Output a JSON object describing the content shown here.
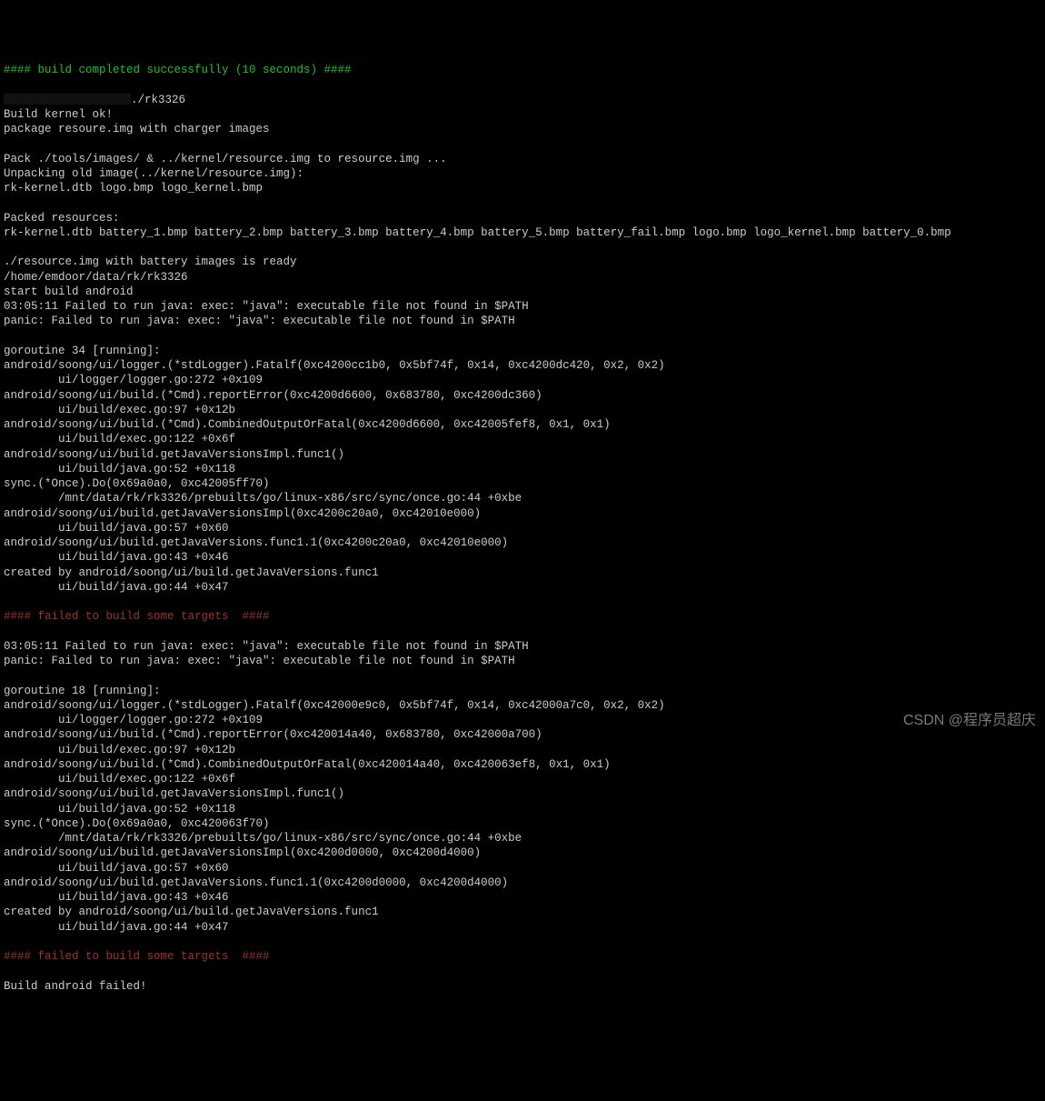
{
  "success_line": "#### build completed successfully (10 seconds) ####",
  "after_redacted": "./rk3326",
  "block1": "Build kernel ok!\npackage resoure.img with charger images\n\nPack ./tools/images/ & ../kernel/resource.img to resource.img ...\nUnpacking old image(../kernel/resource.img):\nrk-kernel.dtb logo.bmp logo_kernel.bmp\n\nPacked resources:\nrk-kernel.dtb battery_1.bmp battery_2.bmp battery_3.bmp battery_4.bmp battery_5.bmp battery_fail.bmp logo.bmp logo_kernel.bmp battery_0.bmp\n\n./resource.img with battery images is ready\n/home/emdoor/data/rk/rk3326\nstart build android\n03:05:11 Failed to run java: exec: \"java\": executable file not found in $PATH\npanic: Failed to run java: exec: \"java\": executable file not found in $PATH\n\ngoroutine 34 [running]:\nandroid/soong/ui/logger.(*stdLogger).Fatalf(0xc4200cc1b0, 0x5bf74f, 0x14, 0xc4200dc420, 0x2, 0x2)\n        ui/logger/logger.go:272 +0x109\nandroid/soong/ui/build.(*Cmd).reportError(0xc4200d6600, 0x683780, 0xc4200dc360)\n        ui/build/exec.go:97 +0x12b\nandroid/soong/ui/build.(*Cmd).CombinedOutputOrFatal(0xc4200d6600, 0xc42005fef8, 0x1, 0x1)\n        ui/build/exec.go:122 +0x6f\nandroid/soong/ui/build.getJavaVersionsImpl.func1()\n        ui/build/java.go:52 +0x118\nsync.(*Once).Do(0x69a0a0, 0xc42005ff70)\n        /mnt/data/rk/rk3326/prebuilts/go/linux-x86/src/sync/once.go:44 +0xbe\nandroid/soong/ui/build.getJavaVersionsImpl(0xc4200c20a0, 0xc42010e000)\n        ui/build/java.go:57 +0x60\nandroid/soong/ui/build.getJavaVersions.func1.1(0xc4200c20a0, 0xc42010e000)\n        ui/build/java.go:43 +0x46\ncreated by android/soong/ui/build.getJavaVersions.func1\n        ui/build/java.go:44 +0x47",
  "fail_line": "#### failed to build some targets  ####",
  "block2": "03:05:11 Failed to run java: exec: \"java\": executable file not found in $PATH\npanic: Failed to run java: exec: \"java\": executable file not found in $PATH\n\ngoroutine 18 [running]:\nandroid/soong/ui/logger.(*stdLogger).Fatalf(0xc42000e9c0, 0x5bf74f, 0x14, 0xc42000a7c0, 0x2, 0x2)\n        ui/logger/logger.go:272 +0x109\nandroid/soong/ui/build.(*Cmd).reportError(0xc420014a40, 0x683780, 0xc42000a700)\n        ui/build/exec.go:97 +0x12b\nandroid/soong/ui/build.(*Cmd).CombinedOutputOrFatal(0xc420014a40, 0xc420063ef8, 0x1, 0x1)\n        ui/build/exec.go:122 +0x6f\nandroid/soong/ui/build.getJavaVersionsImpl.func1()\n        ui/build/java.go:52 +0x118\nsync.(*Once).Do(0x69a0a0, 0xc420063f70)\n        /mnt/data/rk/rk3326/prebuilts/go/linux-x86/src/sync/once.go:44 +0xbe\nandroid/soong/ui/build.getJavaVersionsImpl(0xc4200d0000, 0xc4200d4000)\n        ui/build/java.go:57 +0x60\nandroid/soong/ui/build.getJavaVersions.func1.1(0xc4200d0000, 0xc4200d4000)\n        ui/build/java.go:43 +0x46\ncreated by android/soong/ui/build.getJavaVersions.func1\n        ui/build/java.go:44 +0x47",
  "fail_line2": "#### failed to build some targets  ####",
  "final": "Build android failed!",
  "watermark": "CSDN @程序员超庆"
}
